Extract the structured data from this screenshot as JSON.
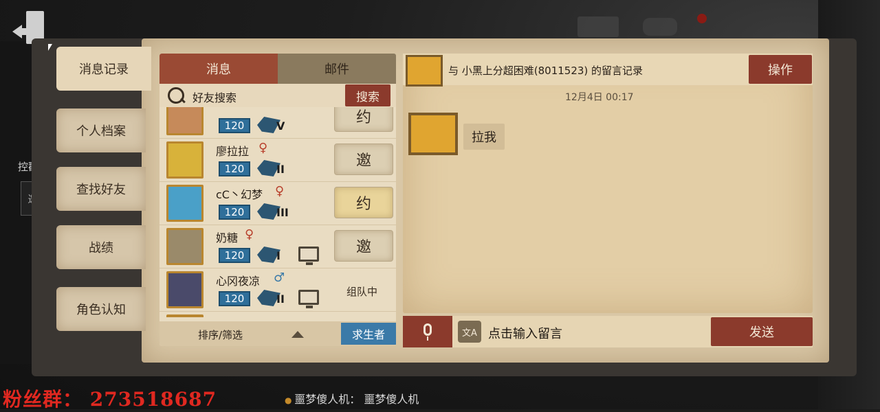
{
  "side_tabs": [
    "消息记录",
    "个人档案",
    "查找好友",
    "战绩",
    "角色认知"
  ],
  "side_hint": "控戳",
  "side_invite": "邀",
  "list": {
    "tabs": [
      "消息",
      "邮件"
    ],
    "search_label": "好友搜索",
    "search_button": "搜索",
    "friends": [
      {
        "name": "",
        "gender": "♀",
        "gender_color": "#b8402c",
        "level": "120",
        "tier": "V",
        "action": "约",
        "status": ""
      },
      {
        "name": "廖拉拉",
        "gender": "♀",
        "gender_color": "#b8402c",
        "level": "120",
        "tier": "II",
        "action": "邀",
        "status": ""
      },
      {
        "name": "cC丶幻梦",
        "gender": "♀",
        "gender_color": "#b8402c",
        "level": "120",
        "tier": "III",
        "action": "约",
        "status": ""
      },
      {
        "name": "奶糖",
        "gender": "♀",
        "gender_color": "#b8402c",
        "level": "120",
        "tier": "I",
        "action": "邀",
        "status": ""
      },
      {
        "name": "心冈夜凉",
        "gender": "♂",
        "gender_color": "#3b7aa8",
        "level": "120",
        "tier": "II",
        "action": "",
        "status": "组队中"
      }
    ],
    "sort_label": "排序/筛选",
    "role_button": "求生者"
  },
  "chat": {
    "title": "与 小黑上分超困难(8011523) 的留言记录",
    "operate_button": "操作",
    "time": "12月4日 00:17",
    "message": "拉我",
    "input_placeholder": "点击输入留言",
    "send_button": "发送"
  },
  "stream": {
    "fans": "粉丝群： 273518687",
    "bot_line": "噩梦傻人机： 噩梦傻人机"
  }
}
